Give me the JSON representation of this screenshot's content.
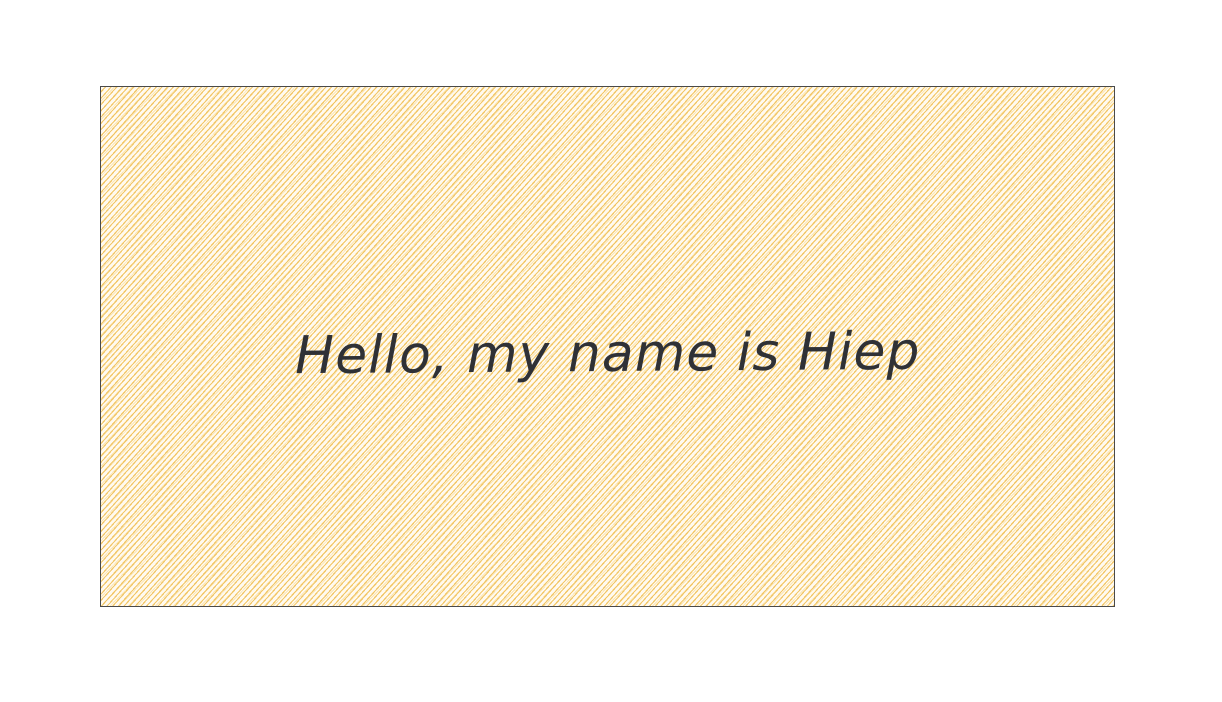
{
  "diagram": {
    "box": {
      "text": "Hello, my name is Hiep",
      "fill_color": "#f5c66a",
      "stroke_color": "#4a4a4a",
      "text_color": "#2f3136"
    }
  }
}
